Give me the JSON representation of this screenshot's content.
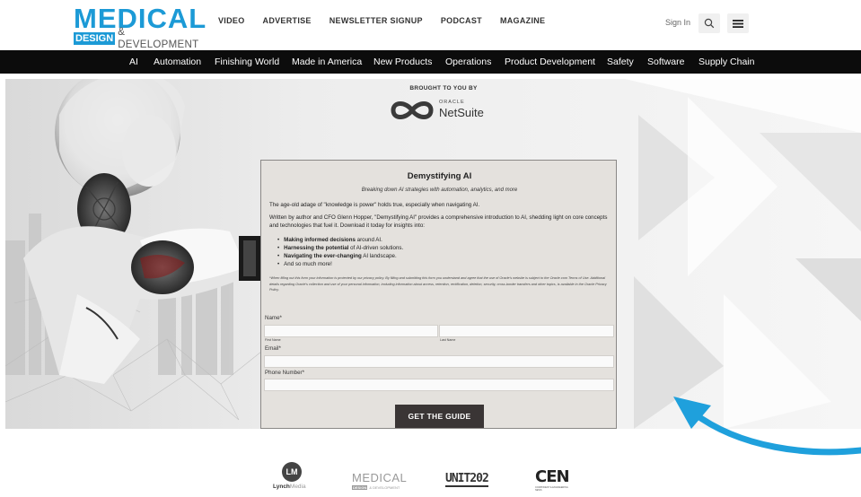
{
  "header": {
    "logo_main": "MEDICAL",
    "logo_design": "DESIGN",
    "logo_dev": "& DEVELOPMENT",
    "topnav": [
      "VIDEO",
      "ADVERTISE",
      "NEWSLETTER SIGNUP",
      "PODCAST",
      "MAGAZINE"
    ],
    "signin": "Sign In",
    "search_icon": "search-icon",
    "menu_icon": "hamburger-menu-icon"
  },
  "mainnav": [
    "AI",
    "Automation",
    "Finishing World",
    "Made in America",
    "New Products",
    "Operations",
    "Product Development",
    "Safety",
    "Software",
    "Supply Chain"
  ],
  "sponsor": {
    "brought": "BROUGHT TO YOU BY",
    "oracle": "ORACLE",
    "netsuite": "NetSuite"
  },
  "form": {
    "title": "Demystifying AI",
    "subtitle": "Breaking down AI strategies with automation, analytics, and more",
    "p1": "The age-old adage of \"knowledge is power\" holds true, especially when navigating AI.",
    "p2": "Written by author and CFO Glenn Hopper, \"Demystifying AI\" provides a comprehensive introduction to AI, shedding light on core concepts and technologies that fuel it. Download it today for insights into:",
    "bullets": [
      {
        "bold": "Making informed decisions",
        "rest": " around AI."
      },
      {
        "bold": "Harnessing the potential",
        "rest": " of AI-driven solutions."
      },
      {
        "bold": "Navigating the ever-changing",
        "rest": " AI landscape."
      },
      {
        "bold": "",
        "rest": "And so much more!"
      }
    ],
    "legal": "*When filling out this form your information is protected by our privacy policy. By filling and submitting this form you understand and agree that the use of Oracle's website is subject to the Oracle.com Terms of Use. Additional details regarding Oracle's collection and use of your personal information, including information about access, retention, rectification, deletion, security, cross-border transfers and other topics, is available in the Oracle Privacy Policy.",
    "name_label": "Name*",
    "first_name": "First Name",
    "last_name": "Last Name",
    "email_label": "Email*",
    "phone_label": "Phone Number*",
    "cta": "GET THE GUIDE"
  },
  "colors": {
    "brand": "#1c9ad6",
    "nav_bg": "#0c0c0c",
    "card_bg": "#e4e1dd",
    "cta_bg": "#3a3535",
    "arrow": "#1fa0dc"
  },
  "footer": {
    "lynch_initials": "LM",
    "lynch_name": "Lynch",
    "lynch_name2": "Media",
    "mdd_main": "MEDICAL",
    "mdd_design": "DESIGN",
    "mdd_dev": "& DEVELOPMENT",
    "unit": "UNIT202",
    "cen": "CEN",
    "cen_sub": "COMPONENT & ENGINEERING NEWS"
  }
}
